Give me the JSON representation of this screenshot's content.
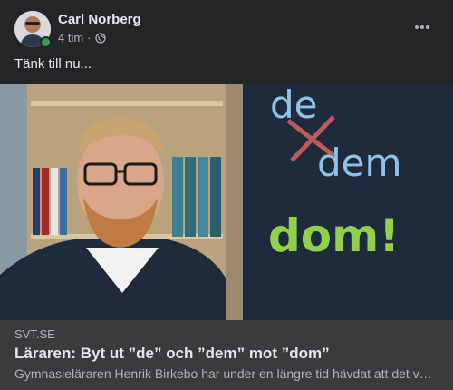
{
  "author": {
    "name": "Carl Norberg",
    "time": "4 tim",
    "separator": "·",
    "privacy_icon": "globe-icon"
  },
  "post": {
    "text": "Tänk till nu..."
  },
  "link": {
    "source": "SVT.SE",
    "headline": "Läraren: Byt ut ”de” och ”dem” mot ”dom”",
    "description": "Gymnasieläraren Henrik Birkebo har under en längre tid hävdat att det vore bättre att byta ut de och dem mot dom",
    "image_text": {
      "line1": "de",
      "line2": "dem",
      "line3": "dom!"
    }
  },
  "colors": {
    "background": "#242526",
    "card": "#3a3b3c",
    "online": "#31a24c",
    "chalk_blue": "#8fc3e8",
    "chalk_red": "#c05a5a",
    "chalk_green": "#8fd14a"
  }
}
